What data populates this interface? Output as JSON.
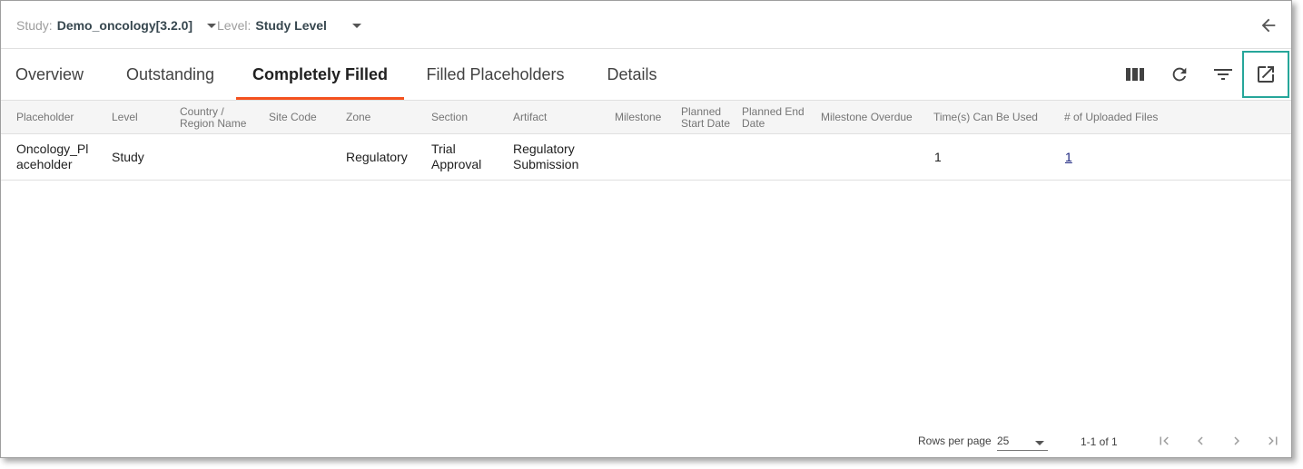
{
  "context": {
    "study_label": "Study:",
    "study_value": "Demo_oncology[3.2.0]",
    "level_label": "Level:",
    "level_value": "Study Level"
  },
  "tabs": [
    {
      "label": "Overview"
    },
    {
      "label": "Outstanding"
    },
    {
      "label": "Completely Filled"
    },
    {
      "label": "Filled Placeholders"
    },
    {
      "label": "Details"
    }
  ],
  "active_tab": "Completely Filled",
  "toolbar_icons": [
    "columns-icon",
    "refresh-icon",
    "filter-icon",
    "open-in-new-icon"
  ],
  "accent_colors": {
    "tab_indicator": "#f4511e",
    "highlight_border": "#26a69a"
  },
  "table": {
    "columns": [
      "Placeholder",
      "Level",
      "Country / Region Name",
      "Site Code",
      "Zone",
      "Section",
      "Artifact",
      "Milestone",
      "Planned Start Date",
      "Planned End Date",
      "Milestone Overdue",
      "Time(s) Can Be Used",
      "# of Uploaded Files"
    ],
    "rows": [
      {
        "placeholder": "Oncology_Placeholder",
        "level": "Study",
        "country": "",
        "site_code": "",
        "zone": "Regulatory",
        "section": "Trial Approval",
        "artifact": "Regulatory Submission",
        "milestone": "",
        "planned_start": "",
        "planned_end": "",
        "milestone_overdue": "",
        "times_can_be_used": "1",
        "uploaded_files": "1"
      }
    ]
  },
  "pagination": {
    "rows_per_page_label": "Rows per page",
    "rows_per_page_value": "25",
    "range_text": "1-1 of 1"
  }
}
